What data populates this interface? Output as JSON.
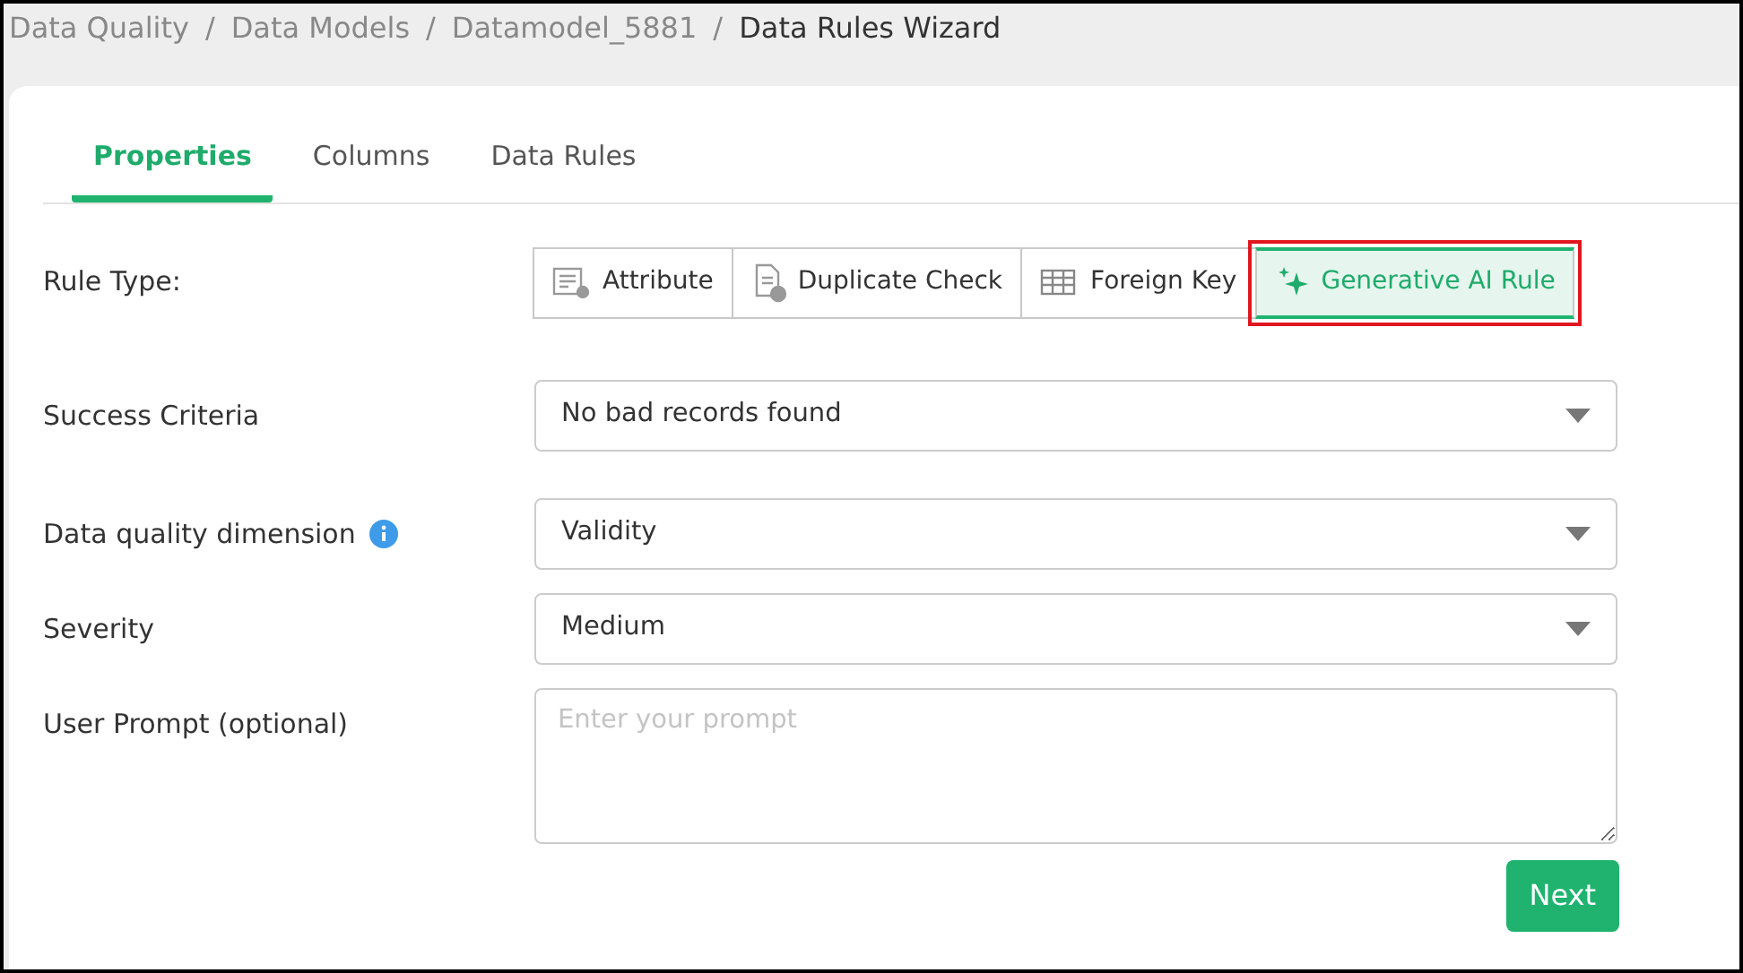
{
  "breadcrumb": [
    {
      "label": "Data Quality",
      "current": false
    },
    {
      "separator": "/",
      "label": "Data Models",
      "current": false
    },
    {
      "separator": "/",
      "label": "Datamodel_5881",
      "current": false
    },
    {
      "separator": "/",
      "label": "Data Rules Wizard",
      "current": true
    }
  ],
  "tabs": [
    {
      "label": "Properties",
      "selected": true
    },
    {
      "label": "Columns",
      "selected": false
    },
    {
      "label": "Data Rules",
      "selected": false
    }
  ],
  "rule_type": {
    "label": "Rule Type:",
    "options": [
      {
        "label": "Attribute",
        "kind": "attribute",
        "selected": false
      },
      {
        "label": "Duplicate Check",
        "kind": "duplicate",
        "selected": false
      },
      {
        "label": "Foreign Key",
        "kind": "table",
        "selected": false
      },
      {
        "label": "Generative AI Rule",
        "kind": "sparkle",
        "selected": true
      }
    ]
  },
  "fields": [
    {
      "label": "Success Criteria",
      "kind": "select",
      "value": "No bad records found",
      "info": false
    },
    {
      "label": "Data quality dimension",
      "kind": "select",
      "value": "Validity",
      "info": true
    },
    {
      "label": "Severity",
      "kind": "select",
      "value": "Medium",
      "info": false
    },
    {
      "label": "User Prompt (optional)",
      "kind": "textarea",
      "placeholder": "Enter your prompt",
      "info": false
    }
  ],
  "next_button": "Next"
}
